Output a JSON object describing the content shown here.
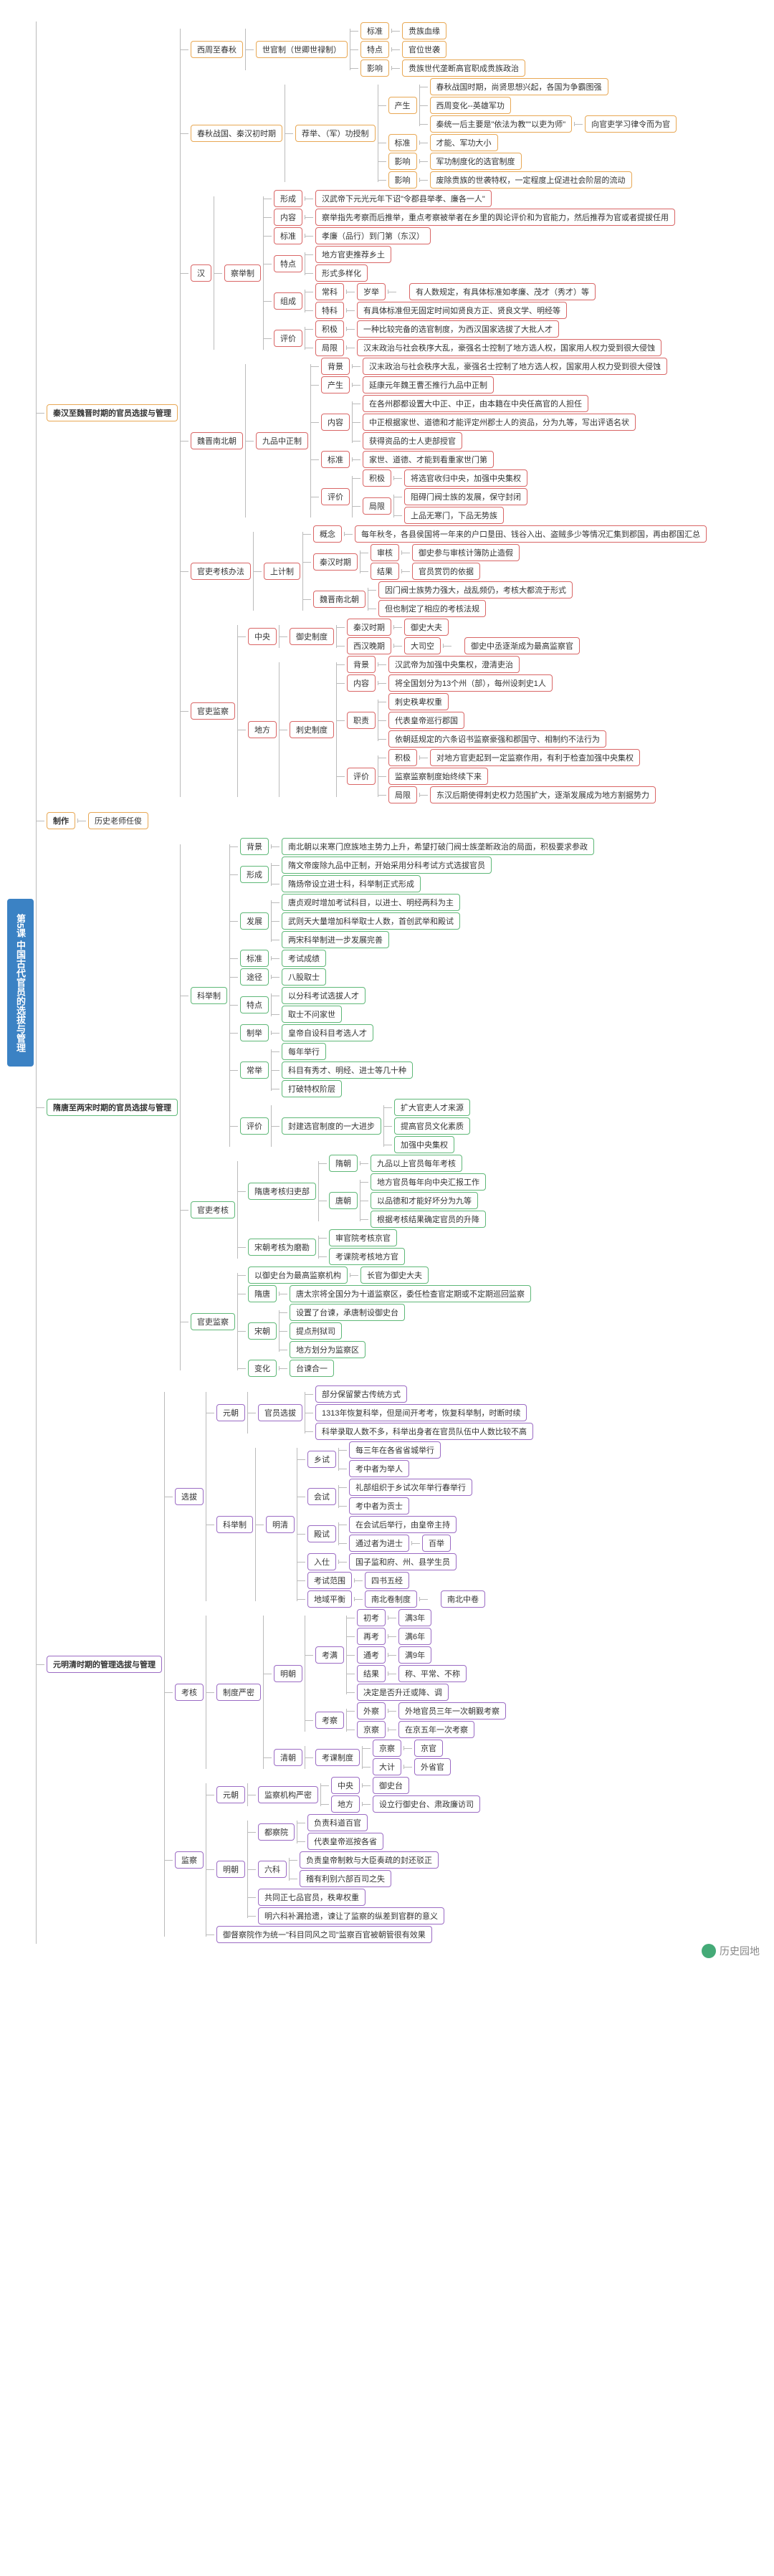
{
  "root": "第5课 中国古代官员的选拔与管理",
  "watermark": "历史园地",
  "sections": [
    {
      "title": "秦汉至魏晋时期的官员选拔与管理",
      "color": "orange",
      "children": [
        {
          "label": "西周至春秋",
          "children": [
            {
              "label": "世官制（世卿世禄制）",
              "children": [
                {
                  "label": "标准",
                  "leaf": "贵族血缘"
                },
                {
                  "label": "特点",
                  "leaf": "官位世袭"
                },
                {
                  "label": "影响",
                  "leaf": "贵族世代垄断高官职成贵族政治"
                }
              ]
            }
          ]
        },
        {
          "label": "春秋战国、秦汉初时期",
          "children": [
            {
              "label": "荐举、（军）功授制",
              "children": [
                {
                  "label": "产生",
                  "children": [
                    {
                      "leaf": "春秋战国时期，尚贤思想兴起，各国为争霸图强"
                    },
                    {
                      "leaf": "西周变化--英雄军功"
                    },
                    {
                      "leaf": "秦统一后主要是\"依法为教\"\"以吏为师\"",
                      "tail": "向官吏学习律令而为官"
                    }
                  ]
                },
                {
                  "label": "标准",
                  "leaf": "才能、军功大小"
                },
                {
                  "label": "影响",
                  "leaf": "军功制度化的选官制度"
                },
                {
                  "label": "影响",
                  "leaf": "废除贵族的世袭特权，一定程度上促进社会阶层的流动"
                }
              ]
            }
          ]
        },
        {
          "label": "汉",
          "color": "red",
          "children": [
            {
              "label": "察举制",
              "children": [
                {
                  "label": "形成",
                  "leaf": "汉武帝下元光元年下诏\"令郡县举孝、廉各一人\""
                },
                {
                  "label": "内容",
                  "children": [
                    {
                      "leaf": "察举指先考察而后推举，重点考察被举者在乡里的舆论评价和为官能力，然后推荐为官或者提拔任用"
                    }
                  ]
                },
                {
                  "label": "标准",
                  "leaf": "孝廉（品行）到门第（东汉）"
                },
                {
                  "label": "特点",
                  "children": [
                    {
                      "leaf": "地方官吏推荐乡土"
                    },
                    {
                      "leaf": "形式多样化"
                    }
                  ]
                },
                {
                  "label": "组成",
                  "children": [
                    {
                      "label": "常科",
                      "leaf": "岁举",
                      "tail": "有人数规定，有具体标准如孝廉、茂才（秀才）等"
                    },
                    {
                      "label": "特科",
                      "leaf": "有具体标准但无固定时间如贤良方正、贤良文学、明经等"
                    }
                  ]
                },
                {
                  "label": "评价",
                  "children": [
                    {
                      "label": "积极",
                      "leaf": "一种比较完备的选官制度，为西汉国家选拔了大批人才"
                    },
                    {
                      "label": "局限",
                      "leaf": "汉末政治与社会秩序大乱，豪强名士控制了地方选人权，国家用人权力受到很大侵蚀"
                    }
                  ]
                }
              ]
            }
          ]
        },
        {
          "label": "魏晋南北朝",
          "color": "red",
          "children": [
            {
              "label": "九品中正制",
              "children": [
                {
                  "label": "背景",
                  "leaf": "汉末政治与社会秩序大乱，豪强名士控制了地方选人权，国家用人权力受到很大侵蚀"
                },
                {
                  "label": "产生",
                  "leaf": "延康元年魏王曹丕推行九品中正制"
                },
                {
                  "label": "内容",
                  "children": [
                    {
                      "leaf": "在各州郡都设置大中正、中正，由本籍在中央任高官的人担任"
                    },
                    {
                      "leaf": "中正根据家世、道德和才能评定州郡士人的资品，分为九等，写出评语名状"
                    },
                    {
                      "leaf": "获得资品的士人吏部授官"
                    }
                  ]
                },
                {
                  "label": "标准",
                  "leaf": "家世、道德、才能到看重家世门第"
                },
                {
                  "label": "评价",
                  "children": [
                    {
                      "label": "积极",
                      "leaf": "将选官收归中央，加强中央集权"
                    },
                    {
                      "label": "局限",
                      "children": [
                        {
                          "leaf": "阻碍门阀士族的发展，保守封闭"
                        },
                        {
                          "leaf": "上品无寒门，下品无势族"
                        }
                      ]
                    }
                  ]
                }
              ]
            }
          ]
        },
        {
          "label": "官吏考核办法",
          "color": "red",
          "children": [
            {
              "label": "上计制",
              "children": [
                {
                  "label": "概念",
                  "leaf": "每年秋冬，各县侯国将一年来的户口垦田、钱谷入出、盗贼多少等情况汇集到郡国，再由郡国汇总"
                },
                {
                  "label": "秦汉时期",
                  "children": [
                    {
                      "label": "审核",
                      "leaf": "御史参与审核计簿防止造假"
                    },
                    {
                      "label": "结果",
                      "leaf": "官员赏罚的依据"
                    }
                  ]
                },
                {
                  "label": "魏晋南北朝",
                  "children": [
                    {
                      "leaf": "因门阀士族势力强大，战乱频仍，考核大都流于形式"
                    },
                    {
                      "leaf": "但也制定了相应的考核法规"
                    }
                  ]
                }
              ]
            }
          ]
        },
        {
          "label": "官吏监察",
          "color": "red",
          "children": [
            {
              "label": "中央",
              "children": [
                {
                  "label": "御史制度",
                  "children": [
                    {
                      "label": "秦汉时期",
                      "leaf": "御史大夫"
                    },
                    {
                      "label": "西汉晚期",
                      "leaf": "大司空",
                      "tail": "御史中丞逐渐成为最高监察官"
                    }
                  ]
                }
              ]
            },
            {
              "label": "地方",
              "children": [
                {
                  "label": "刺史制度",
                  "children": [
                    {
                      "label": "背景",
                      "leaf": "汉武帝为加强中央集权，澄清吏治"
                    },
                    {
                      "label": "内容",
                      "leaf": "将全国划分为13个州（部），每州设刺史1人"
                    },
                    {
                      "label": "职责",
                      "children": [
                        {
                          "leaf": "刺史秩卑权重"
                        },
                        {
                          "leaf": "代表皇帝巡行郡国"
                        },
                        {
                          "leaf": "依朝廷规定的六条诏书监察豪强和郡国守、相制约不法行为"
                        }
                      ]
                    },
                    {
                      "label": "评价",
                      "children": [
                        {
                          "label": "积极",
                          "leaf": "对地方官吏起到一定监察作用，有利于检查加强中央集权"
                        },
                        {
                          "leaf": "监察监察制度始终续下来"
                        },
                        {
                          "label": "局限",
                          "leaf": "东汉后期使得刺史权力范围扩大，逐渐发展成为地方割据势力"
                        }
                      ]
                    }
                  ]
                }
              ]
            }
          ]
        }
      ]
    },
    {
      "title": "制作",
      "color": "orange",
      "leaf": "历史老师任俊"
    },
    {
      "title": "隋唐至两宋时期的官员选拔与管理",
      "color": "green",
      "children": [
        {
          "label": "科举制",
          "children": [
            {
              "label": "背景",
              "leaf": "南北朝以来寒门庶族地主势力上升，希望打破门阀士族垄断政治的局面，积极要求参政"
            },
            {
              "label": "形成",
              "children": [
                {
                  "leaf": "隋文帝废除九品中正制，开始采用分科考试方式选拔官员"
                },
                {
                  "leaf": "隋炀帝设立进士科，科举制正式形成"
                }
              ]
            },
            {
              "label": "发展",
              "children": [
                {
                  "leaf": "唐贞观时增加考试科目，以进士、明经两科为主"
                },
                {
                  "leaf": "武则天大量增加科举取士人数，首创武举和殿试"
                },
                {
                  "leaf": "两宋科举制进一步发展完善"
                }
              ]
            },
            {
              "label": "标准",
              "leaf": "考试成绩"
            },
            {
              "label": "途径",
              "leaf": "八股取士"
            },
            {
              "label": "特点",
              "children": [
                {
                  "leaf": "以分科考试选拔人才"
                },
                {
                  "leaf": "取士不问家世"
                }
              ]
            },
            {
              "label": "制举",
              "leaf": "皇帝自设科目考选人才"
            },
            {
              "label": "常举",
              "children": [
                {
                  "leaf": "每年举行"
                },
                {
                  "leaf": "科目有秀才、明经、进士等几十种"
                },
                {
                  "leaf": "打破特权阶层"
                }
              ]
            },
            {
              "label": "评价",
              "children": [
                {
                  "leaf": "封建选官制度的一大进步",
                  "children": [
                    {
                      "leaf": "扩大官吏人才来源"
                    },
                    {
                      "leaf": "提高官员文化素质"
                    },
                    {
                      "leaf": "加强中央集权"
                    }
                  ]
                }
              ]
            }
          ]
        },
        {
          "label": "官吏考核",
          "children": [
            {
              "label": "隋唐考核归吏部",
              "children": [
                {
                  "label": "隋朝",
                  "leaf": "九品以上官员每年考核"
                },
                {
                  "label": "唐朝",
                  "children": [
                    {
                      "leaf": "地方官员每年向中央汇报工作"
                    },
                    {
                      "leaf": "以品德和才能好坏分为九等"
                    },
                    {
                      "leaf": "根据考核结果确定官员的升降"
                    }
                  ]
                }
              ]
            },
            {
              "label": "宋朝考核为磨勘",
              "children": [
                {
                  "leaf": "审官院考核京官"
                },
                {
                  "leaf": "考课院考核地方官"
                }
              ]
            }
          ]
        },
        {
          "label": "官吏监察",
          "children": [
            {
              "leaf": "以御史台为最高监察机构",
              "tail": "长官为御史大夫"
            },
            {
              "label": "隋唐",
              "leaf": "唐太宗将全国分为十道监察区，委任检查官定期或不定期巡回监察"
            },
            {
              "label": "宋朝",
              "children": [
                {
                  "leaf": "设置了台谏，承唐制设御史台"
                },
                {
                  "leaf": "提点刑狱司"
                },
                {
                  "leaf": "地方划分为监察区"
                }
              ]
            },
            {
              "label": "变化",
              "leaf": "台谏合一"
            }
          ]
        }
      ]
    },
    {
      "title": "元明清时期的管理选拔与管理",
      "color": "purple",
      "children": [
        {
          "label": "选拔",
          "children": [
            {
              "label": "元朝",
              "children": [
                {
                  "label": "官员选拔",
                  "children": [
                    {
                      "leaf": "部分保留蒙古传统方式"
                    },
                    {
                      "leaf": "1313年恢复科举，但是间开考考，恢复科举制，时断时续"
                    },
                    {
                      "leaf": "科举录取人数不多，科举出身者在官员队伍中人数比较不高"
                    }
                  ]
                }
              ]
            },
            {
              "label": "科举制",
              "children": [
                {
                  "label": "明清",
                  "children": [
                    {
                      "label": "乡试",
                      "children": [
                        {
                          "leaf": "每三年在各省省城举行"
                        },
                        {
                          "leaf": "考中者为举人"
                        }
                      ]
                    },
                    {
                      "label": "会试",
                      "children": [
                        {
                          "leaf": "礼部组织于乡试次年举行春举行"
                        },
                        {
                          "leaf": "考中者为贡士"
                        }
                      ]
                    },
                    {
                      "label": "殿试",
                      "children": [
                        {
                          "leaf": "在会试后举行，由皇帝主持"
                        },
                        {
                          "leaf": "通过者为进士",
                          "tail": "百举"
                        }
                      ]
                    },
                    {
                      "label": "入仕",
                      "leaf": "国子监和府、州、县学生员"
                    },
                    {
                      "label": "考试范围",
                      "leaf": "四书五经"
                    },
                    {
                      "label": "地域平衡",
                      "leaf": "南北卷制度",
                      "tail": "南北中卷"
                    }
                  ]
                }
              ]
            }
          ]
        },
        {
          "label": "考核",
          "children": [
            {
              "label": "制度严密",
              "children": [
                {
                  "label": "明朝",
                  "children": [
                    {
                      "label": "考满",
                      "children": [
                        {
                          "label": "初考",
                          "leaf": "满3年"
                        },
                        {
                          "label": "再考",
                          "leaf": "满6年"
                        },
                        {
                          "label": "通考",
                          "leaf": "满9年"
                        },
                        {
                          "label": "结果",
                          "leaf": "称、平常、不称"
                        },
                        {
                          "leaf": "决定是否升迁或降、调"
                        }
                      ]
                    },
                    {
                      "label": "考察",
                      "children": [
                        {
                          "label": "外察",
                          "leaf": "外地官员三年一次朝觐考察"
                        },
                        {
                          "label": "京察",
                          "leaf": "在京五年一次考察"
                        }
                      ]
                    }
                  ]
                },
                {
                  "label": "清朝",
                  "children": [
                    {
                      "label": "考课制度",
                      "children": [
                        {
                          "label": "京察",
                          "leaf": "京官"
                        },
                        {
                          "label": "大计",
                          "leaf": "外省官"
                        }
                      ]
                    }
                  ]
                }
              ]
            }
          ]
        },
        {
          "label": "监察",
          "children": [
            {
              "label": "元朝",
              "children": [
                {
                  "label": "监察机构严密",
                  "children": [
                    {
                      "label": "中央",
                      "leaf": "御史台"
                    },
                    {
                      "label": "地方",
                      "leaf": "设立行御史台、肃政廉访司"
                    }
                  ]
                }
              ]
            },
            {
              "label": "明朝",
              "children": [
                {
                  "label": "都察院",
                  "children": [
                    {
                      "leaf": "负责科道百官"
                    },
                    {
                      "leaf": "代表皇帝巡按各省"
                    }
                  ]
                },
                {
                  "label": "六科",
                  "children": [
                    {
                      "leaf": "负责皇帝制敕与大臣奏疏的封还驳正"
                    },
                    {
                      "leaf": "稽有利别六部百司之失"
                    }
                  ]
                },
                {
                  "leaf": "共同正七品官员，秩卑权重"
                },
                {
                  "leaf": "明六科补漏拾遗，谏让了监察的纵差到官群的意义"
                }
              ]
            },
            {
              "leaf": "御督察院作为统一\"科目同风之司\"监察百官被朝管很有效果"
            }
          ]
        }
      ]
    }
  ]
}
